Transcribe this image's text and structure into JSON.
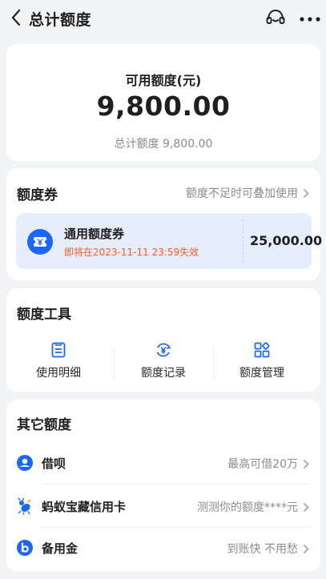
{
  "header": {
    "title": "总计额度",
    "support_icon": "headset-icon",
    "more_icon": "more-icon"
  },
  "summary": {
    "available_label": "可用额度(元)",
    "available_amount": "9,800.00",
    "total_text": "总计额度 9,800.00"
  },
  "coupons": {
    "title": "额度券",
    "hint": "额度不足时可叠加使用",
    "item": {
      "name": "通用额度券",
      "expiry": "即将在2023-11-11 23:59失效",
      "amount": "25,000.00"
    }
  },
  "tools": {
    "title": "额度工具",
    "items": [
      {
        "label": "使用明细",
        "icon": "document-list-icon"
      },
      {
        "label": "额度记录",
        "icon": "yuan-refresh-icon"
      },
      {
        "label": "额度管理",
        "icon": "grid-manage-icon"
      }
    ]
  },
  "others": {
    "title": "其它额度",
    "items": [
      {
        "label": "借呗",
        "right": "最高可借20万",
        "icon": "jiebei-icon"
      },
      {
        "label": "蚂蚁宝藏信用卡",
        "right": "测测你的额度****元",
        "icon": "ant-card-icon"
      },
      {
        "label": "备用金",
        "right": "到账快 不用愁",
        "icon": "beiyongjin-icon"
      }
    ]
  },
  "colors": {
    "accent": "#1a66ff",
    "warning": "#ff5a1f",
    "coupon_bg": "#e6eefb"
  }
}
